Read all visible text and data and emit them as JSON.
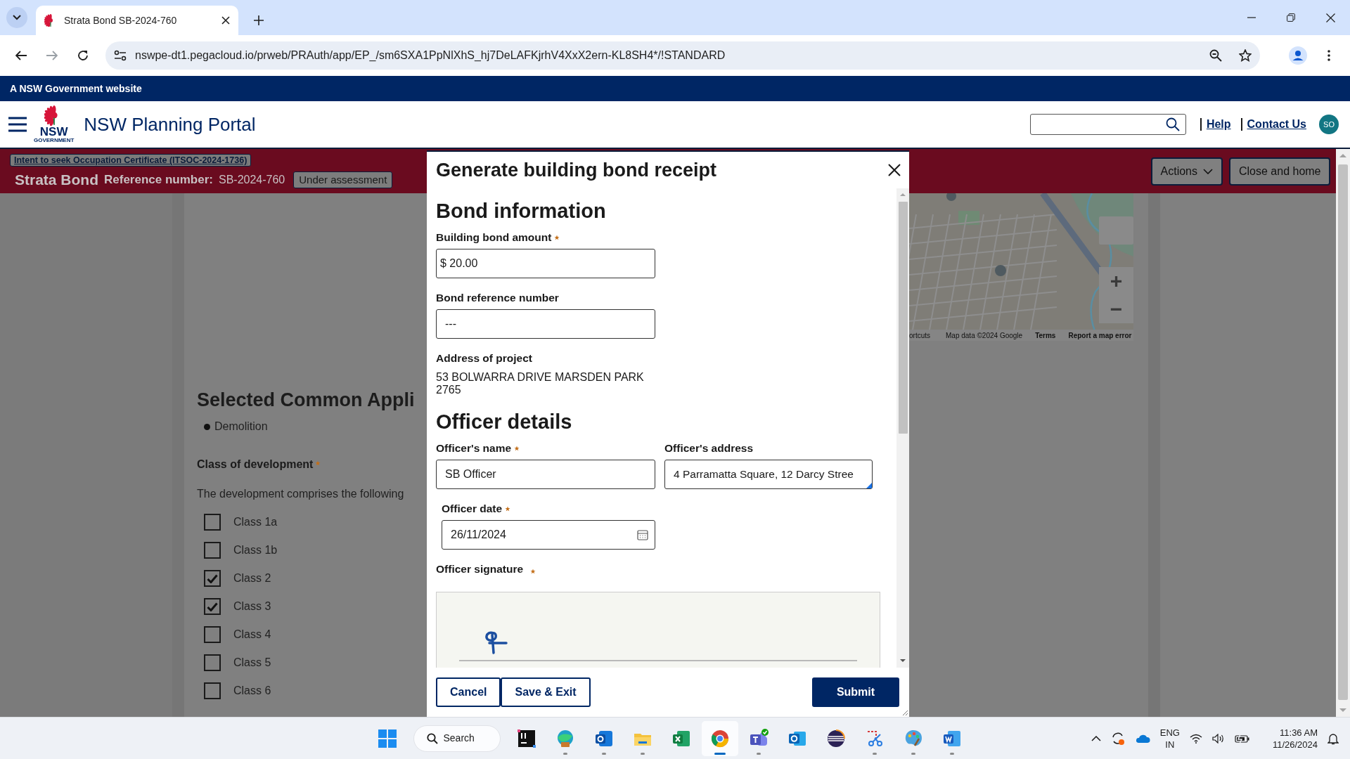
{
  "browser": {
    "tab_title": "Strata Bond SB-2024-760",
    "url": "nswpe-dt1.pegacloud.io/prweb/PRAuth/app/EP_/sm6SXA1PpNlXhS_hj7DeLAFKjrhV4XxX2ern-KL8SH4*/!STANDARD"
  },
  "gov_banner": "A NSW Government website",
  "header": {
    "logo_text": "NSW",
    "logo_subtext": "GOVERNMENT",
    "title": "NSW Planning Portal",
    "links": [
      "Help",
      "Contact Us"
    ],
    "avatar": "SO"
  },
  "case_bar": {
    "parent_link": "Intent to seek Occupation Certificate (ITSOC-2024-1736)",
    "case_type": "Strata Bond",
    "ref_label": "Reference number:",
    "ref_value": "SB-2024-760",
    "status": "Under assessment",
    "buttons": [
      {
        "label": "Actions",
        "kind": "dropdown"
      },
      {
        "label": "Close and home",
        "kind": "plain"
      }
    ]
  },
  "page": {
    "heading": "Selected Common Appli",
    "bullets": [
      "Demolition"
    ],
    "class_label": "Class of development",
    "class_required": true,
    "intro": "The development comprises the following",
    "classes": [
      {
        "label": "Class 1a",
        "checked": false
      },
      {
        "label": "Class 1b",
        "checked": false
      },
      {
        "label": "Class 2",
        "checked": true
      },
      {
        "label": "Class 3",
        "checked": true
      },
      {
        "label": "Class 4",
        "checked": false
      },
      {
        "label": "Class 5",
        "checked": false
      },
      {
        "label": "Class 6",
        "checked": false
      }
    ]
  },
  "map": {
    "footer": [
      "ortcuts",
      "Map data ©2024 Google",
      "Terms",
      "Report a map error"
    ],
    "zoom_in": "+",
    "zoom_out": "−"
  },
  "modal": {
    "title": "Generate building bond receipt",
    "sections": [
      {
        "heading": "Bond information",
        "rows": [
          [
            {
              "kind": "input",
              "label": "Building bond amount",
              "required": true,
              "value": "$ 20.00"
            }
          ],
          [
            {
              "kind": "input",
              "label": "Bond reference number",
              "required": false,
              "value": "---"
            }
          ],
          [
            {
              "kind": "text",
              "label": "Address of project",
              "value": "53 BOLWARRA DRIVE MARSDEN PARK 2765"
            }
          ]
        ]
      },
      {
        "heading": "Officer details",
        "rows": [
          [
            {
              "kind": "input",
              "label": "Officer's name",
              "required": true,
              "value": "SB Officer"
            },
            {
              "kind": "textarea",
              "label": "Officer's address",
              "required": false,
              "value": "4 Parramatta Square, 12 Darcy Stree"
            }
          ],
          [
            {
              "kind": "date",
              "label": "Officer date",
              "required": true,
              "value": "26/11/2024"
            }
          ],
          [
            {
              "kind": "signature",
              "label": "Officer signature",
              "required": true
            }
          ]
        ]
      }
    ],
    "buttons": [
      {
        "label": "Cancel",
        "kind": "secondary"
      },
      {
        "label": "Save & Exit",
        "kind": "secondary"
      },
      {
        "label": "Submit",
        "kind": "primary"
      }
    ]
  },
  "taskbar": {
    "search": "Search",
    "apps": [
      {
        "running": false,
        "selected": false
      },
      {
        "running": true,
        "selected": false
      },
      {
        "running": true,
        "selected": false
      },
      {
        "running": true,
        "selected": false
      },
      {
        "running": false,
        "selected": false
      },
      {
        "running": true,
        "selected": true
      },
      {
        "running": true,
        "selected": false
      },
      {
        "running": false,
        "selected": false
      },
      {
        "running": false,
        "selected": false
      },
      {
        "running": true,
        "selected": false
      },
      {
        "running": true,
        "selected": false
      },
      {
        "running": true,
        "selected": false
      }
    ],
    "language": "ENG",
    "region": "IN",
    "time": "11:36 AM",
    "date": "11/26/2024"
  }
}
